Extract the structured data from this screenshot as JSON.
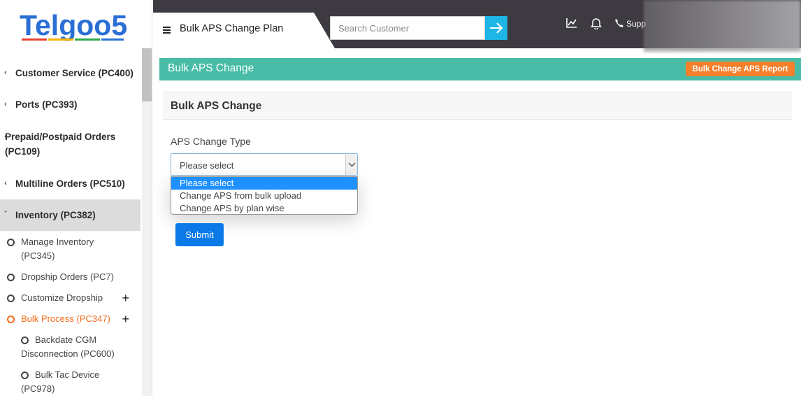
{
  "logo": {
    "text": "Telgoo5"
  },
  "sidebar": {
    "items": [
      {
        "label": "Customer Service (PC400)"
      },
      {
        "label": "Ports (PC393)"
      },
      {
        "label": "Prepaid/Postpaid Orders (PC109)"
      },
      {
        "label": "Multiline Orders (PC510)"
      },
      {
        "label": "Inventory (PC382)"
      }
    ],
    "subitems": [
      {
        "label": "Manage Inventory (PC345)"
      },
      {
        "label": "Dropship Orders (PC7)"
      },
      {
        "label": "Customize Dropship"
      },
      {
        "label": "Bulk Process (PC347)"
      }
    ],
    "subsubitems": [
      {
        "label": "Backdate CGM Disconnection (PC600)"
      },
      {
        "label": "Bulk Tac Device (PC978)"
      }
    ]
  },
  "topbar": {
    "page_title": "Bulk APS Change Plan",
    "search_placeholder": "Search Customer",
    "support_label": "Supp"
  },
  "main": {
    "band_title": "Bulk APS Change",
    "report_button": "Bulk Change APS Report",
    "card_title": "Bulk APS Change",
    "field_label": "APS Change Type",
    "select_value": "Please select",
    "options": [
      "Please select",
      "Change APS from bulk upload",
      "Change APS by plan wise"
    ],
    "submit_label": "Submit"
  },
  "colors": {
    "brand_blue": "#2a6fd6",
    "brand_orange": "#f26b1d",
    "teal_band": "#48bca7",
    "topbar_dark": "#3e3a41",
    "primary_button": "#0b7ae8",
    "report_button": "#f57f2a"
  }
}
